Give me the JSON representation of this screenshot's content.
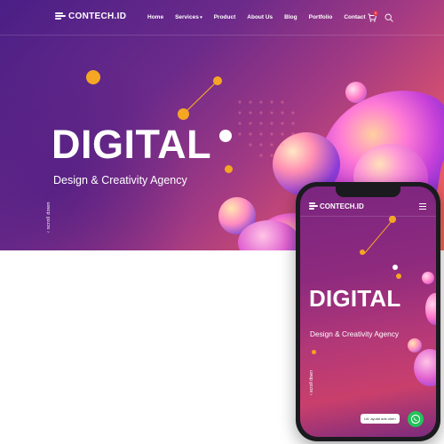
{
  "brand": {
    "name": "CONTECH.ID"
  },
  "nav": {
    "items": [
      "Home",
      "Services",
      "Product",
      "About Us",
      "Blog",
      "Portfolio",
      "Contact"
    ]
  },
  "cart": {
    "badge": "0"
  },
  "hero": {
    "title": "DIGITAL",
    "subtitle": "Design & Creativity Agency",
    "scroll_text": "scroll down"
  },
  "mobile": {
    "brand": "CONTECH.ID",
    "title": "DIGITAL",
    "subtitle": "Design & Creativity Agency",
    "scroll_text": "scroll down",
    "chat_label": "Ud. ayulat ads ohen"
  },
  "icons": {
    "cart": "cart-icon",
    "search": "search-icon",
    "menu": "hamburger-menu-icon",
    "chat": "whatsapp-icon"
  },
  "colors": {
    "accent_orange": "#f5a623",
    "gradient_start": "#4a1f86",
    "gradient_end": "#f06a55",
    "whatsapp_green": "#23c25a"
  }
}
